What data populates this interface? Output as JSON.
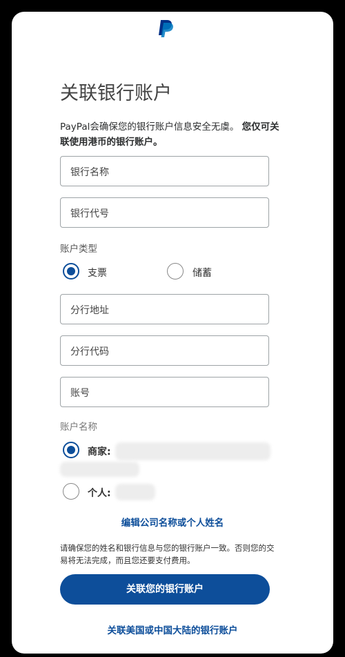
{
  "header": {
    "logo_icon": "paypal-logo"
  },
  "page": {
    "title": "关联银行账户",
    "intro_plain": "PayPal会确保您的银行账户信息安全无虞。",
    "intro_bold": "您仅可关联使用港币的银行账户。"
  },
  "fields": {
    "bank_name": "银行名称",
    "bank_code": "银行代号",
    "branch_address": "分行地址",
    "branch_code": "分行代码",
    "account_number": "账号"
  },
  "account_type": {
    "label": "账户类型",
    "options": [
      "支票",
      "储蓄"
    ],
    "selected": "支票"
  },
  "account_name": {
    "label": "账户名称",
    "business_label": "商家:",
    "personal_label": "个人:",
    "selected": "商家"
  },
  "edit_link": "编辑公司名称或个人姓名",
  "notice": "请确保您的姓名和银行信息与您的银行账户一致。否则您的交易将无法完成，而且您还要支付费用。",
  "primary_button": "关联您的银行账户",
  "bottom_link": "关联美国或中国大陆的银行账户",
  "colors": {
    "brand": "#0d4e9a",
    "background": "#000000"
  }
}
